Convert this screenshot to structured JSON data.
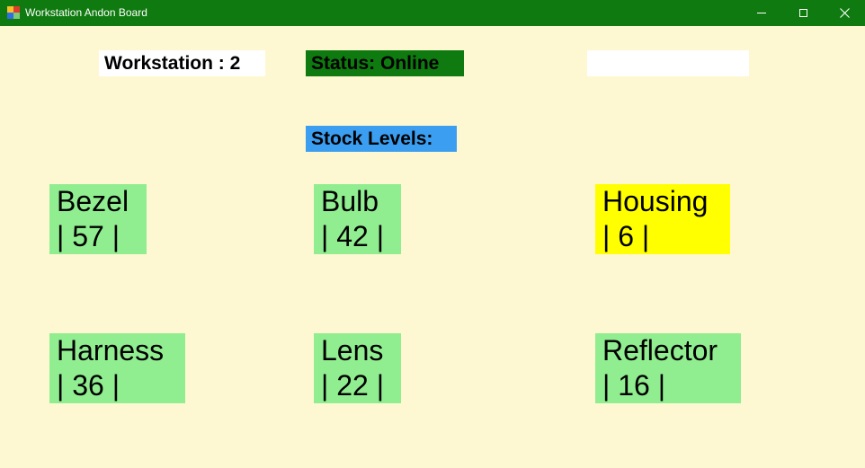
{
  "window": {
    "title": "Workstation Andon Board",
    "colors": {
      "titlebar": "#0f7a0f",
      "background": "#fef8d2"
    }
  },
  "header": {
    "workstation_label": "Workstation : 2",
    "status_label": "Status: Online",
    "status_color": "#0f7a0f",
    "blank_field_color": "#ffffff"
  },
  "stock": {
    "heading": "Stock Levels:",
    "heading_color": "#3b9ef0",
    "items": [
      {
        "name": "Bezel",
        "count": "| 57 |",
        "color": "#90ee90"
      },
      {
        "name": "Bulb",
        "count": "| 42 |",
        "color": "#90ee90"
      },
      {
        "name": "Housing",
        "count": "| 6 |",
        "color": "#ffff00"
      },
      {
        "name": "Harness",
        "count": "| 36 |",
        "color": "#90ee90"
      },
      {
        "name": "Lens",
        "count": "| 22 |",
        "color": "#90ee90"
      },
      {
        "name": "Reflector",
        "count": "| 16 |",
        "color": "#90ee90"
      }
    ]
  }
}
